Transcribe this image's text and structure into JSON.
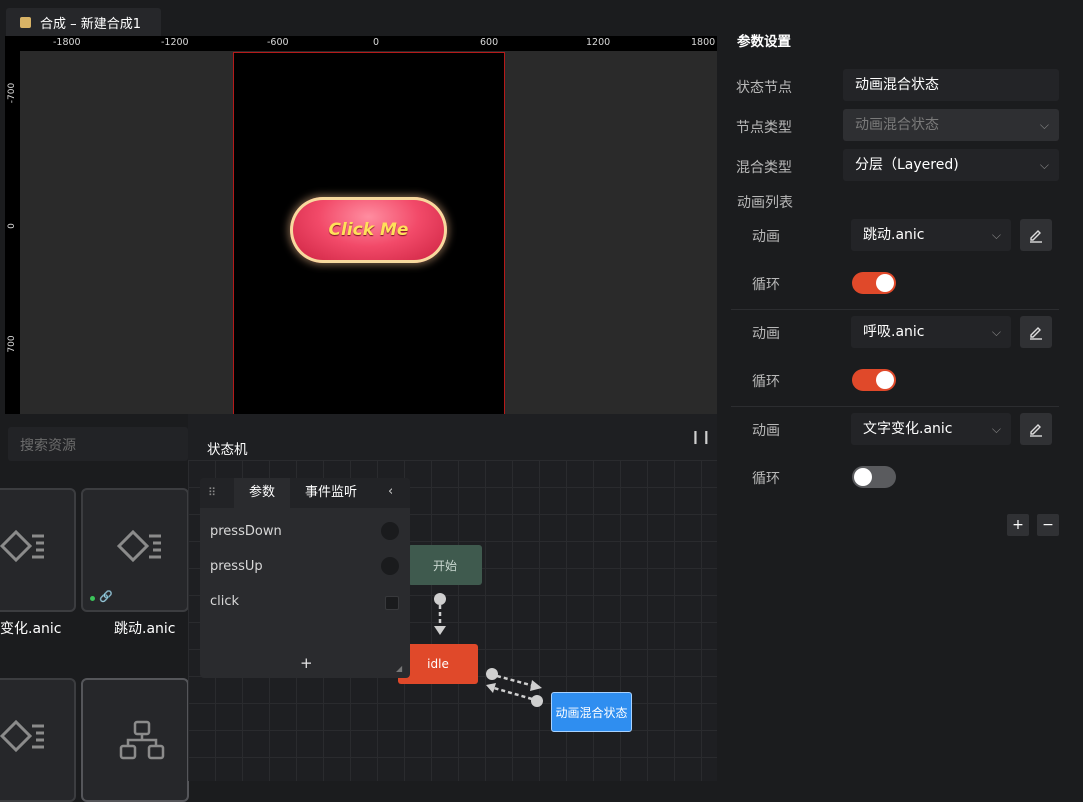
{
  "tab": {
    "title": "合成 – 新建合成1"
  },
  "ruler": {
    "h_labels": [
      "-1800",
      "-1200",
      "-600",
      "0",
      "600",
      "1200",
      "1800"
    ],
    "v_labels": [
      "-700",
      "0",
      "700"
    ]
  },
  "stage": {
    "button_text": "Click Me"
  },
  "assets": {
    "search_placeholder": "搜索资源",
    "items": [
      {
        "name": "变化.anic"
      },
      {
        "name": "跳动.anic"
      }
    ]
  },
  "state_machine": {
    "title": "状态机",
    "pause_icon": "pause-icon",
    "param_panel": {
      "tabs": [
        "参数",
        "事件监听"
      ],
      "params": [
        {
          "name": "pressDown",
          "kind": "trigger"
        },
        {
          "name": "pressUp",
          "kind": "trigger"
        },
        {
          "name": "click",
          "kind": "bool"
        }
      ],
      "add_label": "+"
    },
    "nodes": {
      "start": "开始",
      "idle": "idle",
      "blend": "动画混合状态"
    }
  },
  "settings": {
    "title": "参数设置",
    "state_node_label": "状态节点",
    "state_node_value": "动画混合状态",
    "node_type_label": "节点类型",
    "node_type_value": "动画混合状态",
    "blend_type_label": "混合类型",
    "blend_type_value": "分层（Layered)",
    "anim_list_label": "动画列表",
    "animations": [
      {
        "anim_label": "动画",
        "anim_value": "跳动.anic",
        "loop_label": "循环",
        "loop": true
      },
      {
        "anim_label": "动画",
        "anim_value": "呼吸.anic",
        "loop_label": "循环",
        "loop": true
      },
      {
        "anim_label": "动画",
        "anim_value": "文字变化.anic",
        "loop_label": "循环",
        "loop": false
      }
    ],
    "add_btn": "+",
    "remove_btn": "−"
  },
  "colors": {
    "accent_red": "#e0492a",
    "node_blue": "#2f8ef0",
    "node_green": "#3f5a4e",
    "toggle_off": "#5a5b5e"
  }
}
